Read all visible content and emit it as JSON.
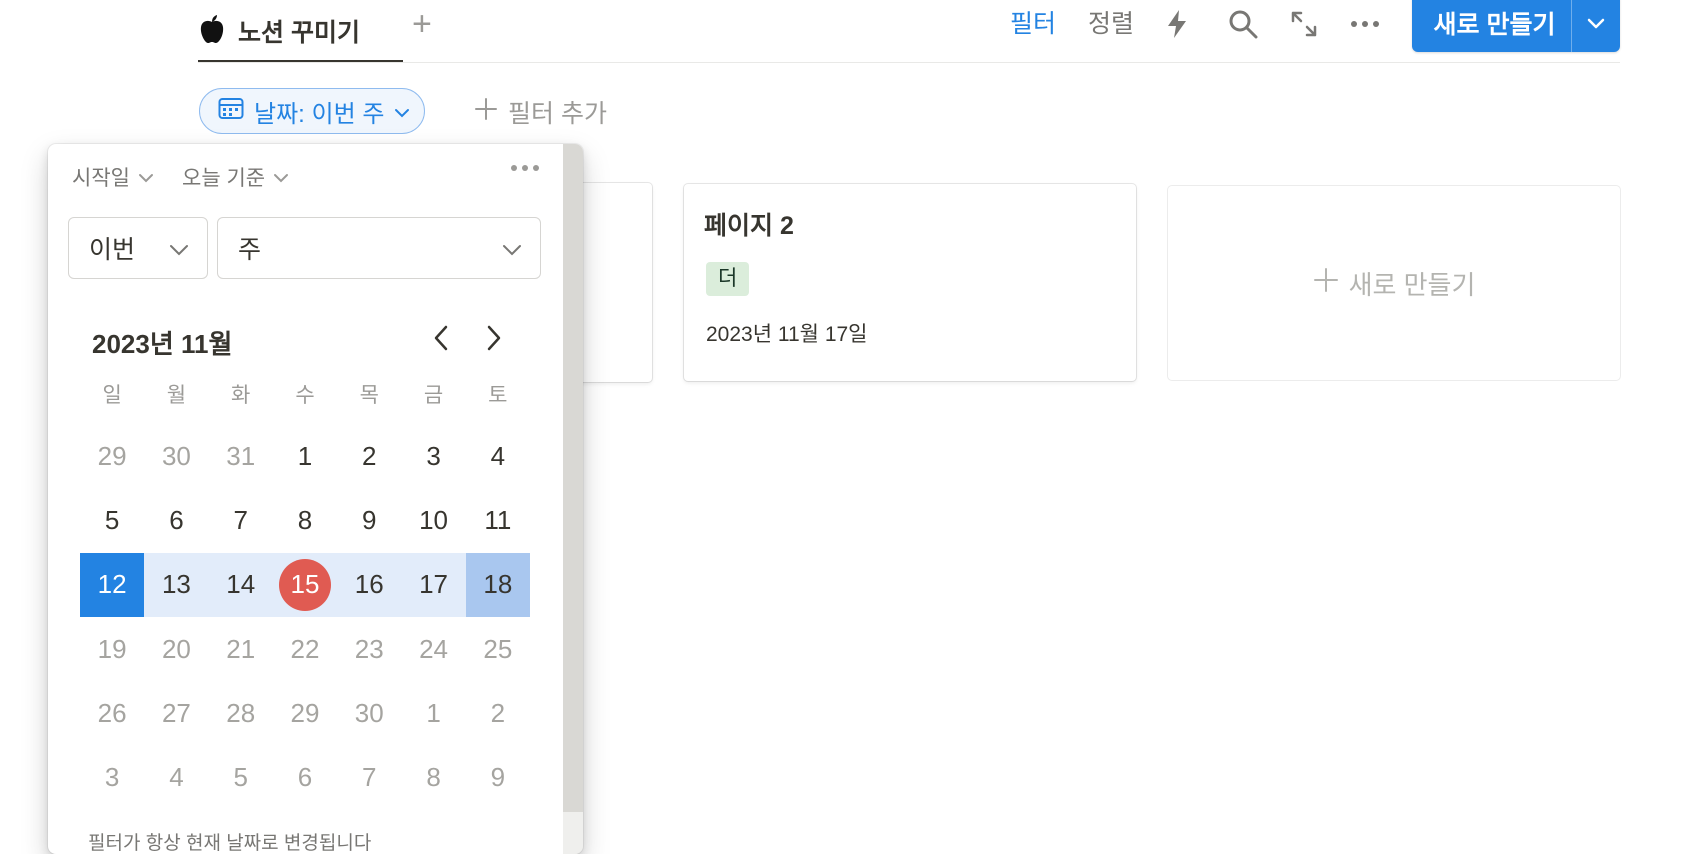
{
  "tabs": {
    "active_label": "노션 꾸미기",
    "active_icon": "apple-icon",
    "add_view_icon": "plus-icon"
  },
  "toolbar": {
    "filter_label": "필터",
    "sort_label": "정렬",
    "icons": [
      "lightning-icon",
      "search-icon",
      "expand-icon",
      "more-icon"
    ],
    "new_button_label": "새로 만들기",
    "accent_color": "#2383e2"
  },
  "filters": {
    "active_chip": "날짜: 이번 주",
    "add_filter_label": "필터 추가"
  },
  "board": {
    "cards": [
      {
        "title": "페이지 2",
        "tag": "더",
        "date": "2023년 11월 17일"
      }
    ],
    "new_card_label": "새로 만들기"
  },
  "date_popup": {
    "field_label": "시작일",
    "relative_label": "오늘 기준",
    "period_value": "이번",
    "unit_value": "주",
    "month_title": "2023년 11월",
    "weekdays": [
      "일",
      "월",
      "화",
      "수",
      "목",
      "금",
      "토"
    ],
    "weeks": [
      [
        "29",
        "30",
        "31",
        "1",
        "2",
        "3",
        "4"
      ],
      [
        "5",
        "6",
        "7",
        "8",
        "9",
        "10",
        "11"
      ],
      [
        "12",
        "13",
        "14",
        "15",
        "16",
        "17",
        "18"
      ],
      [
        "19",
        "20",
        "21",
        "22",
        "23",
        "24",
        "25"
      ],
      [
        "26",
        "27",
        "28",
        "29",
        "30",
        "1",
        "2"
      ],
      [
        "3",
        "4",
        "5",
        "6",
        "7",
        "8",
        "9"
      ]
    ],
    "today": "15",
    "selected_week_index": 2,
    "today_color": "#e05b52",
    "helper_text": "필터가 항상 현재 날짜로 변경됩니다"
  }
}
